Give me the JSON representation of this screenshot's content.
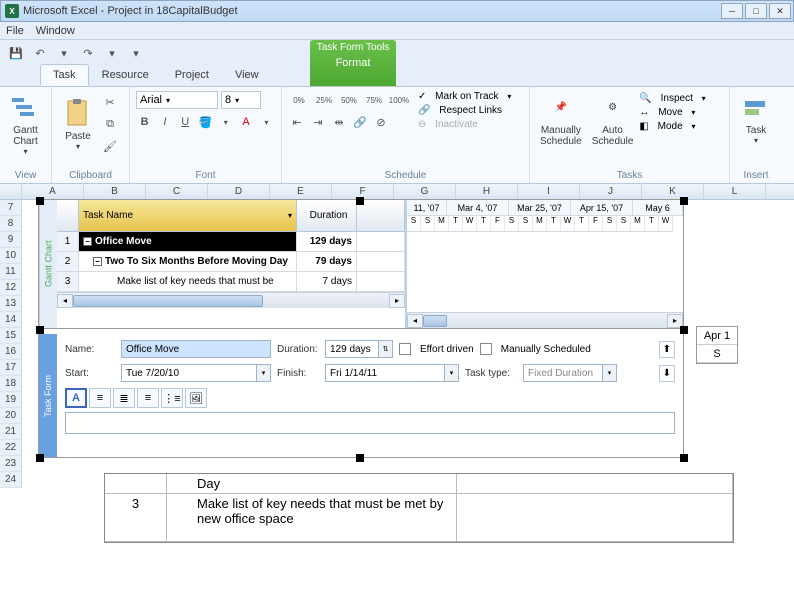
{
  "title": "Microsoft Excel - Project in 18CapitalBudget",
  "menu": {
    "file": "File",
    "window": "Window"
  },
  "tabs": {
    "task": "Task",
    "resource": "Resource",
    "project": "Project",
    "view": "View",
    "ctx_title": "Task Form Tools",
    "ctx_tab": "Format"
  },
  "groups": {
    "view": "View",
    "clipboard": "Clipboard",
    "font": "Font",
    "schedule": "Schedule",
    "tasks": "Tasks",
    "insert": "Insert"
  },
  "ribbon": {
    "gantt": "Gantt\nChart",
    "paste": "Paste",
    "font_name": "Arial",
    "font_size": "8",
    "pct0": "0%",
    "pct25": "25%",
    "pct50": "50%",
    "pct75": "75%",
    "pct100": "100%",
    "mark": "Mark on Track",
    "respect": "Respect Links",
    "inactivate": "Inactivate",
    "manual": "Manually\nSchedule",
    "auto": "Auto\nSchedule",
    "inspect": "Inspect",
    "move": "Move",
    "mode": "Mode",
    "task": "Task"
  },
  "cols": [
    "",
    "A",
    "B",
    "C",
    "D",
    "E",
    "F",
    "G",
    "H",
    "I",
    "J",
    "K",
    "L"
  ],
  "rows": [
    "7",
    "8",
    "9",
    "10",
    "11",
    "12",
    "13",
    "14",
    "15",
    "16",
    "17",
    "18",
    "19",
    "20",
    "21",
    "22",
    "23",
    "24"
  ],
  "gantt": {
    "vtab": "Gantt Chart",
    "taskname": "Task Name",
    "duration": "Duration",
    "r1": {
      "id": "1",
      "name": "Office Move",
      "dur": "129 days"
    },
    "r2": {
      "id": "2",
      "name": "Two To Six Months Before Moving Day",
      "dur": "79 days"
    },
    "r3": {
      "id": "3",
      "name": "Make list of key needs that must be",
      "dur": "7 days"
    },
    "dates": [
      "11, '07",
      "Mar 4, '07",
      "Mar 25, '07",
      "Apr 15, '07",
      "May 6"
    ],
    "days": [
      "S",
      "S",
      "M",
      "T",
      "W",
      "T",
      "F",
      "S",
      "S",
      "M",
      "T",
      "W",
      "T",
      "F",
      "S",
      "S",
      "M",
      "T",
      "W"
    ]
  },
  "apr": {
    "d1": "Apr 1",
    "d2": "S"
  },
  "tf": {
    "vtab": "Task Form",
    "name_l": "Name:",
    "name_v": "Office Move",
    "dur_l": "Duration:",
    "dur_v": "129 days",
    "eff": "Effort driven",
    "man": "Manually Scheduled",
    "start_l": "Start:",
    "start_v": "Tue 7/20/10",
    "finish_l": "Finish:",
    "finish_v": "Fri 1/14/11",
    "type_l": "Task type:",
    "type_v": "Fixed Duration"
  },
  "frag": {
    "day": "Day",
    "id": "3",
    "txt": "Make list of key needs that must be met by new office space"
  }
}
